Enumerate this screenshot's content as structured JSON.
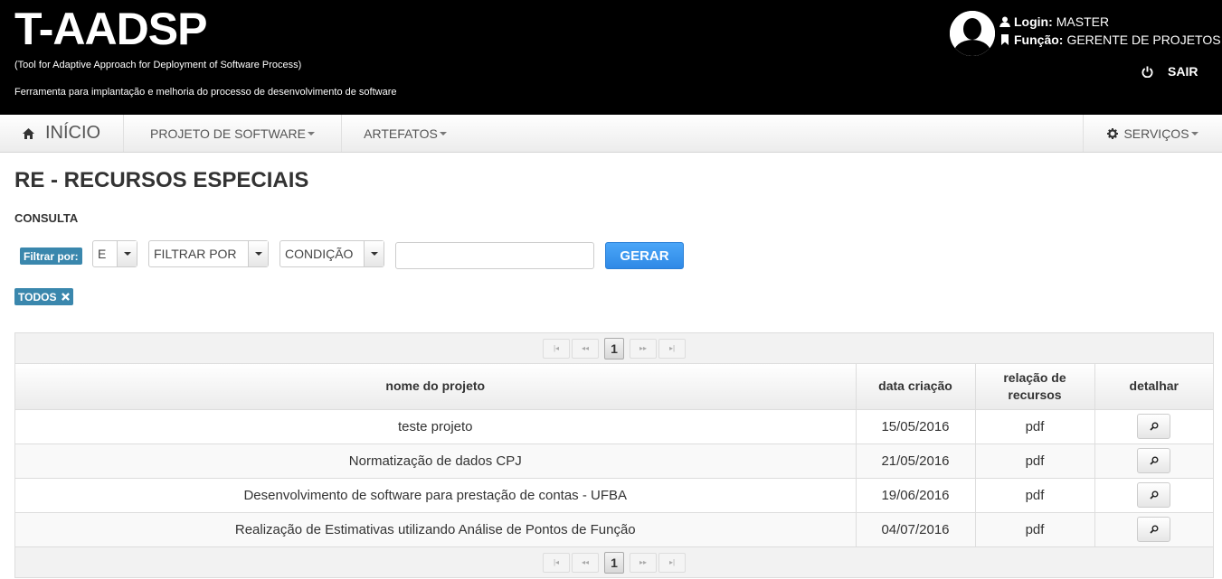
{
  "header": {
    "title": "T-AADSP",
    "subtitle": "(Tool for Adaptive Approach for Deployment of Software Process)",
    "description": "Ferramenta para implantação e melhoria do processo de desenvolvimento de software",
    "login_label": "Login:",
    "login_value": "MASTER",
    "role_label": "Função:",
    "role_value": "GERENTE DE PROJETOS",
    "logout_label": "SAIR"
  },
  "nav": {
    "home": "INÍCIO",
    "projeto": "PROJETO DE SOFTWARE",
    "artefatos": "ARTEFATOS",
    "servicos": "SERVIÇOS"
  },
  "page": {
    "title": "RE - RECURSOS ESPECIAIS",
    "section": "CONSULTA"
  },
  "filter": {
    "label": "Filtrar por:",
    "logic_value": "E",
    "field_value": "FILTRAR POR",
    "condition_value": "CONDIÇÃO",
    "search_value": "",
    "submit_label": "GERAR",
    "active_tag": "TODOS"
  },
  "pager": {
    "first": "|◂",
    "prev": "◂◂",
    "current": "1",
    "next": "▸▸",
    "last": "▸|"
  },
  "table": {
    "headers": [
      "nome do projeto",
      "data criação",
      "relação de recursos",
      "detalhar"
    ],
    "rows": [
      {
        "name": "teste projeto",
        "date": "15/05/2016",
        "resources": "pdf"
      },
      {
        "name": "Normatização de dados CPJ",
        "date": "21/05/2016",
        "resources": "pdf"
      },
      {
        "name": "Desenvolvimento de software para prestação de contas - UFBA",
        "date": "19/06/2016",
        "resources": "pdf"
      },
      {
        "name": "Realização de Estimativas utilizando Análise de Pontos de Função",
        "date": "04/07/2016",
        "resources": "pdf"
      }
    ]
  },
  "colors": {
    "header_bg": "#000000",
    "label_bg": "#3a87ad",
    "primary_button": "#3b95ee"
  },
  "icons": [
    "avatar-icon",
    "user-icon",
    "bookmark-icon",
    "power-icon",
    "home-icon",
    "gear-icon",
    "close-icon",
    "magnifier-icon"
  ]
}
